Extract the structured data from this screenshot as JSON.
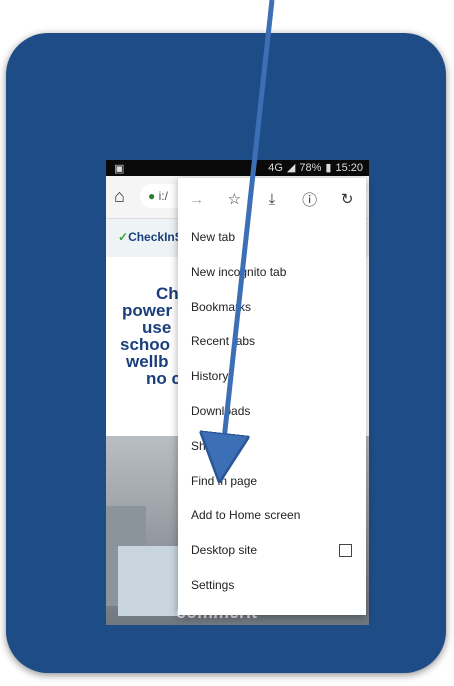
{
  "status_bar": {
    "left_icon": "image-icon",
    "signal_label": "4G",
    "battery": "78%",
    "time": "15:20"
  },
  "url_bar": {
    "home_icon": "home-icon",
    "lock_icon": "lock-icon",
    "url_text": "i:/"
  },
  "site": {
    "logo_text": "CheckInS",
    "hero_lines": [
      "Ch",
      "power",
      "use",
      "schoo",
      "wellb",
      "no c"
    ],
    "photo_caption": "commerit"
  },
  "menu": {
    "toolbar_icons": [
      "forward-icon",
      "star-icon",
      "download-icon",
      "info-icon",
      "refresh-icon"
    ],
    "items": [
      {
        "label": "New tab"
      },
      {
        "label": "New incognito tab"
      },
      {
        "label": "Bookmarks"
      },
      {
        "label": "Recent tabs"
      },
      {
        "label": "History"
      },
      {
        "label": "Downloads"
      },
      {
        "label": "Share..."
      },
      {
        "label": "Find in page"
      },
      {
        "label": "Add to Home screen"
      },
      {
        "label": "Desktop site"
      },
      {
        "label": "Settings"
      }
    ]
  },
  "colors": {
    "card": "#1e4c86",
    "arrow": "#3d6fb6",
    "brand": "#1b3f7a"
  }
}
